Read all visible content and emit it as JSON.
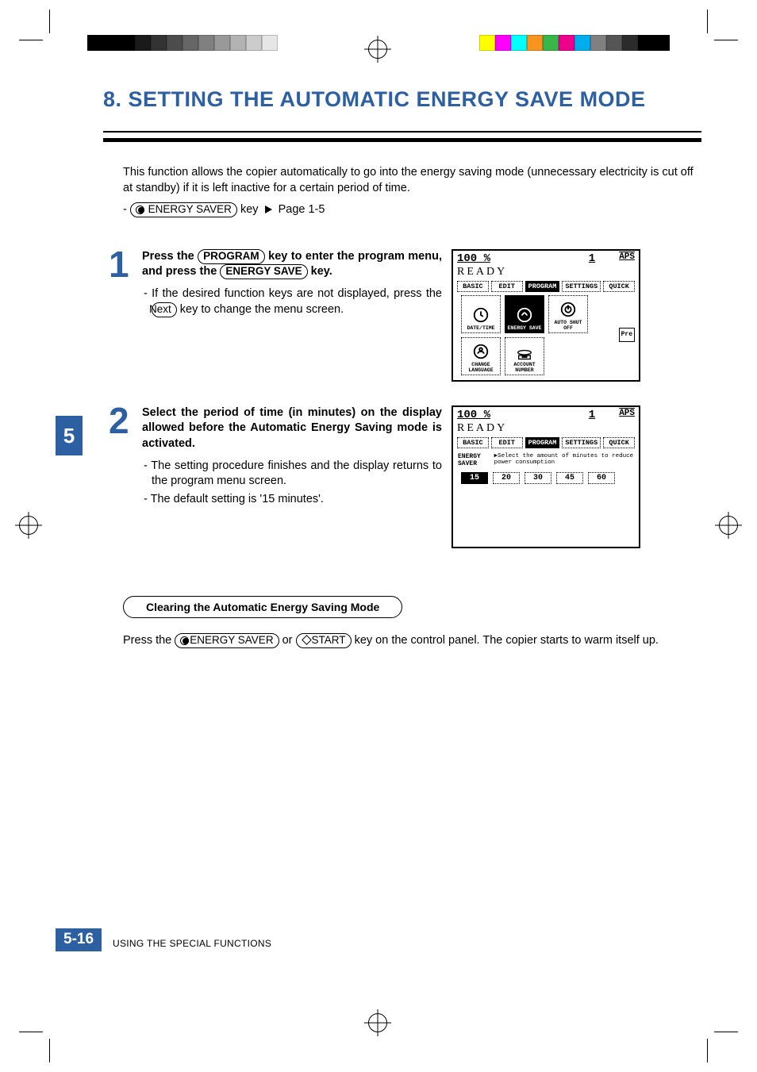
{
  "colorbars": {
    "left_greys": [
      "#000",
      "#000",
      "#000",
      "#1a1a1a",
      "#333",
      "#4d4d4d",
      "#666",
      "#808080",
      "#999",
      "#b3b3b3",
      "#ccc",
      "#e6e6e6"
    ],
    "right_colors": [
      "#ff0",
      "#f0f",
      "#0ff",
      "#f7931e",
      "#39b54a",
      "#ec008c",
      "#00aeef",
      "#808080",
      "#555",
      "#2b2b2b",
      "#000",
      "#000"
    ]
  },
  "heading": "8. SETTING THE AUTOMATIC ENERGY SAVE MODE",
  "intro_text": "This function allows the copier automatically to go into the energy saving mode (unnecessary electricity is cut off at standby) if it is left inactive for a certain period of time.",
  "intro_key": "ENERGY SAVER",
  "intro_ref": "Page 1-5",
  "chapter_tab": "5",
  "step1": {
    "num": "1",
    "lead_a": "Press the ",
    "key1": "PROGRAM",
    "lead_b": " key to enter the program menu, and press the ",
    "key2": "ENERGY SAVE",
    "lead_c": " key.",
    "bullet_a": "If the desired function keys are not displayed, press the ",
    "bullet_key": "Next",
    "bullet_b": " key to change the menu screen."
  },
  "step2": {
    "num": "2",
    "lead": "Select the period of time (in minutes) on the display allowed before the Automatic Energy Saving mode is activated.",
    "bullet1": "The setting procedure finishes and the display returns to the program menu screen.",
    "bullet2": "The default setting is '15 minutes'."
  },
  "screen_common": {
    "pct": "100  %",
    "count": "1",
    "aps": "APS",
    "ready": "READY",
    "tabs": [
      "BASIC",
      "EDIT",
      "PROGRAM",
      "SETTINGS",
      "QUICK"
    ],
    "active_tab": 2
  },
  "screen1": {
    "icons": [
      "DATE/TIME",
      "ENERGY SAVE",
      "AUTO SHUT OFF",
      "CHANGE LANGUAGE",
      "ACCOUNT NUMBER"
    ],
    "active_icon": 1,
    "pre": "Pre"
  },
  "screen2": {
    "label": "ENERGY SAVER",
    "prompt": "Select the amount of minutes to reduce power consumption",
    "minutes": [
      "15",
      "20",
      "30",
      "45",
      "60"
    ],
    "selected": 0
  },
  "clearing": {
    "heading": "Clearing the Automatic Energy Saving Mode",
    "text_a": "Press the ",
    "key1": "ENERGY SAVER",
    "text_b": " or ",
    "key2": "START",
    "text_c": " key on the control panel.  The copier starts to warm itself up."
  },
  "footer": {
    "page": "5-16",
    "chapter": "USING THE SPECIAL FUNCTIONS"
  }
}
